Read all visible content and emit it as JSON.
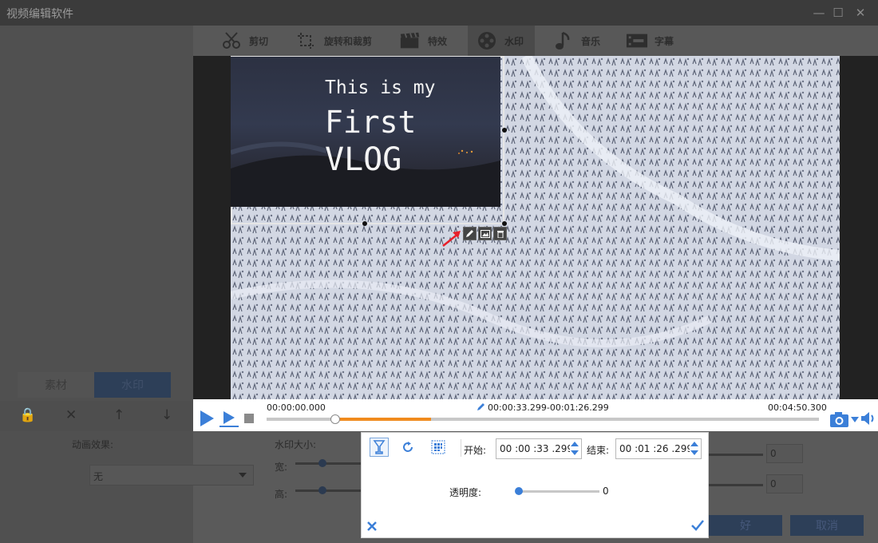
{
  "window": {
    "title": "视频编辑软件"
  },
  "toolbar": {
    "items": [
      {
        "label": "剪切",
        "icon": "scissors-icon"
      },
      {
        "label": "旋转和裁剪",
        "icon": "crop-rotate-icon"
      },
      {
        "label": "特效",
        "icon": "clapperboard-icon"
      },
      {
        "label": "水印",
        "icon": "film-reel-icon",
        "active": true
      },
      {
        "label": "音乐",
        "icon": "music-note-icon"
      },
      {
        "label": "字幕",
        "icon": "subtitle-icon"
      }
    ]
  },
  "left_panel": {
    "tabs": [
      "素材",
      "水印"
    ],
    "active_tab": "水印",
    "animation_label": "动画效果:",
    "animation_value": "无"
  },
  "size_panel": {
    "title": "水印大小:",
    "width_label": "宽:",
    "height_label": "高:",
    "spin_right_top": "0",
    "spin_right_bottom": "0"
  },
  "watermark": {
    "line1": "This is my",
    "line2": "First",
    "line3": "VLOG"
  },
  "playback": {
    "start_time": "00:00:00.000",
    "range": "00:00:33.299-00:01:26.299",
    "end_time": "00:04:50.300"
  },
  "popup": {
    "start_label": "开始:",
    "start_value": "00 :00 :33 .299",
    "end_label": "结束:",
    "end_value": "00 :01 :26 .299",
    "opacity_label": "透明度:",
    "opacity_value": "0"
  },
  "dialog_buttons": {
    "ok": "好",
    "cancel": "取消"
  },
  "colors": {
    "accent": "#3b7fd8",
    "range": "#f08b1e"
  }
}
